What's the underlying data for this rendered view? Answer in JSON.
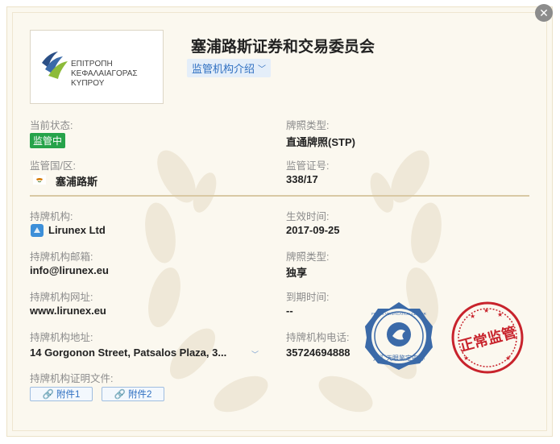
{
  "header": {
    "title": "塞浦路斯证券和交易委员会",
    "intro_tab": "监管机构介绍"
  },
  "logo": {
    "text_line1": "ΕΠΙΤΡΟΠΗ",
    "text_line2": "ΚΕΦΑΛΑΙΑΓΟΡΑΣ",
    "text_line3": "ΚΥΠΡΟΥ"
  },
  "status": {
    "label": "当前状态:",
    "value": "监管中",
    "color": "#26a34a"
  },
  "license_type": {
    "label": "牌照类型:",
    "value": "直通牌照(STP)"
  },
  "region": {
    "label": "监管国/区:",
    "value": "塞浦路斯"
  },
  "reg_no": {
    "label": "监管证号:",
    "value": "338/17"
  },
  "holder": {
    "label": "持牌机构:",
    "value": "Lirunex Ltd"
  },
  "effective": {
    "label": "生效时间:",
    "value": "2017-09-25"
  },
  "email": {
    "label": "持牌机构邮箱:",
    "value": "info@lirunex.eu"
  },
  "license_kind": {
    "label": "牌照类型:",
    "value": "独享"
  },
  "website": {
    "label": "持牌机构网址:",
    "value": "www.lirunex.eu"
  },
  "expiry": {
    "label": "到期时间:",
    "value": "--"
  },
  "address": {
    "label": "持牌机构地址:",
    "value": "14 Gorgonon Street, Patsalos Plaza, 3..."
  },
  "phone": {
    "label": "持牌机构电话:",
    "value": "35724694888"
  },
  "docs": {
    "label": "持牌机构证明文件:",
    "attachments": [
      "附件1",
      "附件2"
    ]
  },
  "seals": {
    "blue_bottom": "外汇天眼鉴定中心",
    "blue_top": "FOREX VERIFICATION CENTER",
    "red": "正常监管"
  },
  "colors": {
    "accent": "#2e6fc1",
    "divider": "#d9c9a4",
    "seal_red": "#c8232c",
    "seal_blue": "#3b6aa8"
  }
}
